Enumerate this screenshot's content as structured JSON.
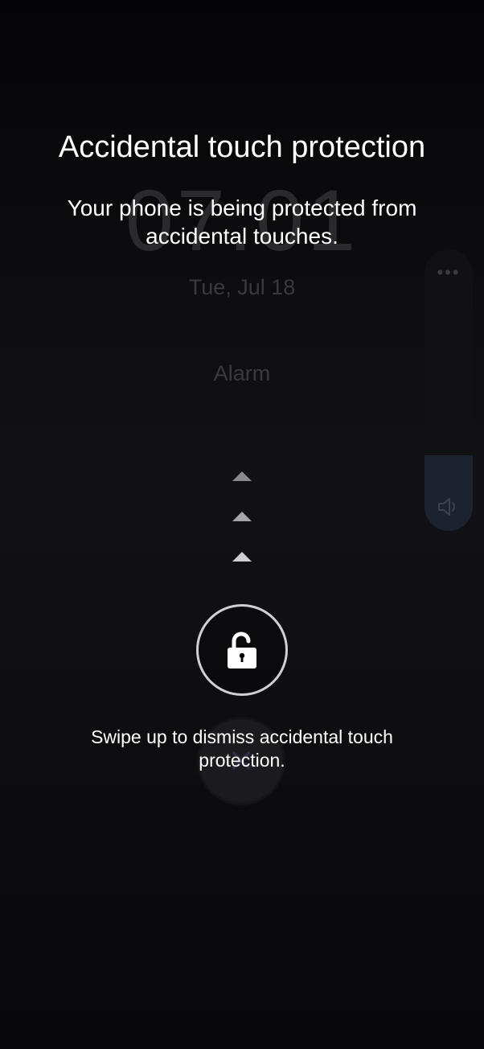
{
  "background": {
    "clock": "07:01",
    "date": "Tue, Jul 18",
    "alarm_label": "Alarm",
    "dismiss_icon": "close-icon"
  },
  "volume": {
    "level": 0.27,
    "menu_icon": "more-dots-icon",
    "speaker_icon": "speaker-icon"
  },
  "overlay": {
    "title": "Accidental touch protection",
    "message": "Your phone is being protected from accidental touches.",
    "unlock_icon": "unlocked-padlock-icon",
    "hint": "Swipe up to dismiss accidental touch protection.",
    "swipe_arrows": 3
  },
  "colors": {
    "background": "#0b0b0e",
    "text": "#ffffff",
    "ring": "#d0d0d0"
  }
}
